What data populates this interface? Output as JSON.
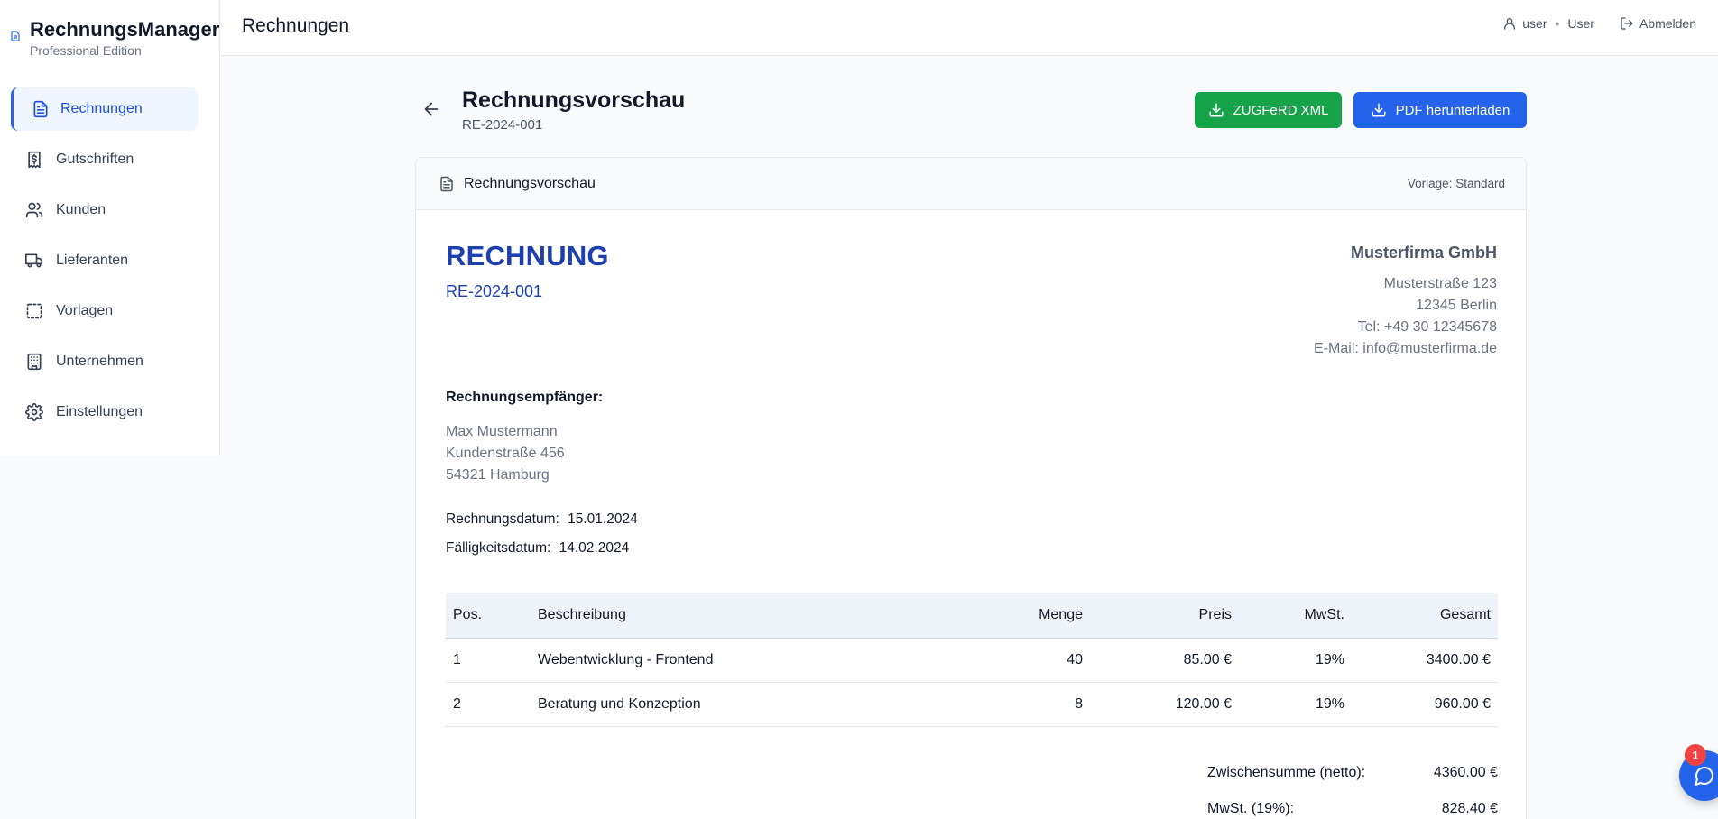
{
  "brand": {
    "name": "RechnungsManager",
    "subtitle": "Professional Edition"
  },
  "sidebar": {
    "items": [
      {
        "label": "Rechnungen",
        "icon": "file-text-icon",
        "active": true
      },
      {
        "label": "Gutschriften",
        "icon": "receipt-dollar-icon"
      },
      {
        "label": "Kunden",
        "icon": "users-icon"
      },
      {
        "label": "Lieferanten",
        "icon": "truck-icon"
      },
      {
        "label": "Vorlagen",
        "icon": "layout-dashed-icon"
      },
      {
        "label": "Unternehmen",
        "icon": "building-icon"
      },
      {
        "label": "Einstellungen",
        "icon": "gear-icon"
      }
    ]
  },
  "topbar": {
    "title": "Rechnungen",
    "username": "user",
    "role": "User",
    "logout_label": "Abmelden"
  },
  "header": {
    "title": "Rechnungsvorschau",
    "invoice_id": "RE-2024-001",
    "zugferd_label": "ZUGFeRD XML",
    "pdf_label": "PDF herunterladen"
  },
  "card": {
    "title": "Rechnungsvorschau",
    "template_label": "Vorlage: Standard"
  },
  "invoice": {
    "heading": "RECHNUNG",
    "number": "RE-2024-001",
    "seller": {
      "name": "Musterfirma GmbH",
      "street": "Musterstraße 123",
      "city": "12345 Berlin",
      "phone": "Tel: +49 30 12345678",
      "email": "E-Mail: info@musterfirma.de"
    },
    "recipient_label": "Rechnungsempfänger:",
    "recipient": {
      "name": "Max Mustermann",
      "street": "Kundenstraße 456",
      "city": "54321 Hamburg"
    },
    "date_label": "Rechnungsdatum:",
    "date": "15.01.2024",
    "due_label": "Fälligkeitsdatum:",
    "due": "14.02.2024",
    "columns": [
      "Pos.",
      "Beschreibung",
      "Menge",
      "Preis",
      "MwSt.",
      "Gesamt"
    ],
    "rows": [
      [
        "1",
        "Webentwicklung - Frontend",
        "40",
        "85.00 €",
        "19%",
        "3400.00 €"
      ],
      [
        "2",
        "Beratung und Konzeption",
        "8",
        "120.00 €",
        "19%",
        "960.00 €"
      ]
    ],
    "totals": [
      {
        "label": "Zwischensumme (netto):",
        "value": "4360.00 €"
      },
      {
        "label": "MwSt. (19%):",
        "value": "828.40 €"
      }
    ]
  },
  "chat": {
    "badge": "1"
  },
  "colors": {
    "primary": "#2563eb",
    "success": "#16a34a",
    "heading": "#1e40af",
    "badge": "#ef4444"
  }
}
